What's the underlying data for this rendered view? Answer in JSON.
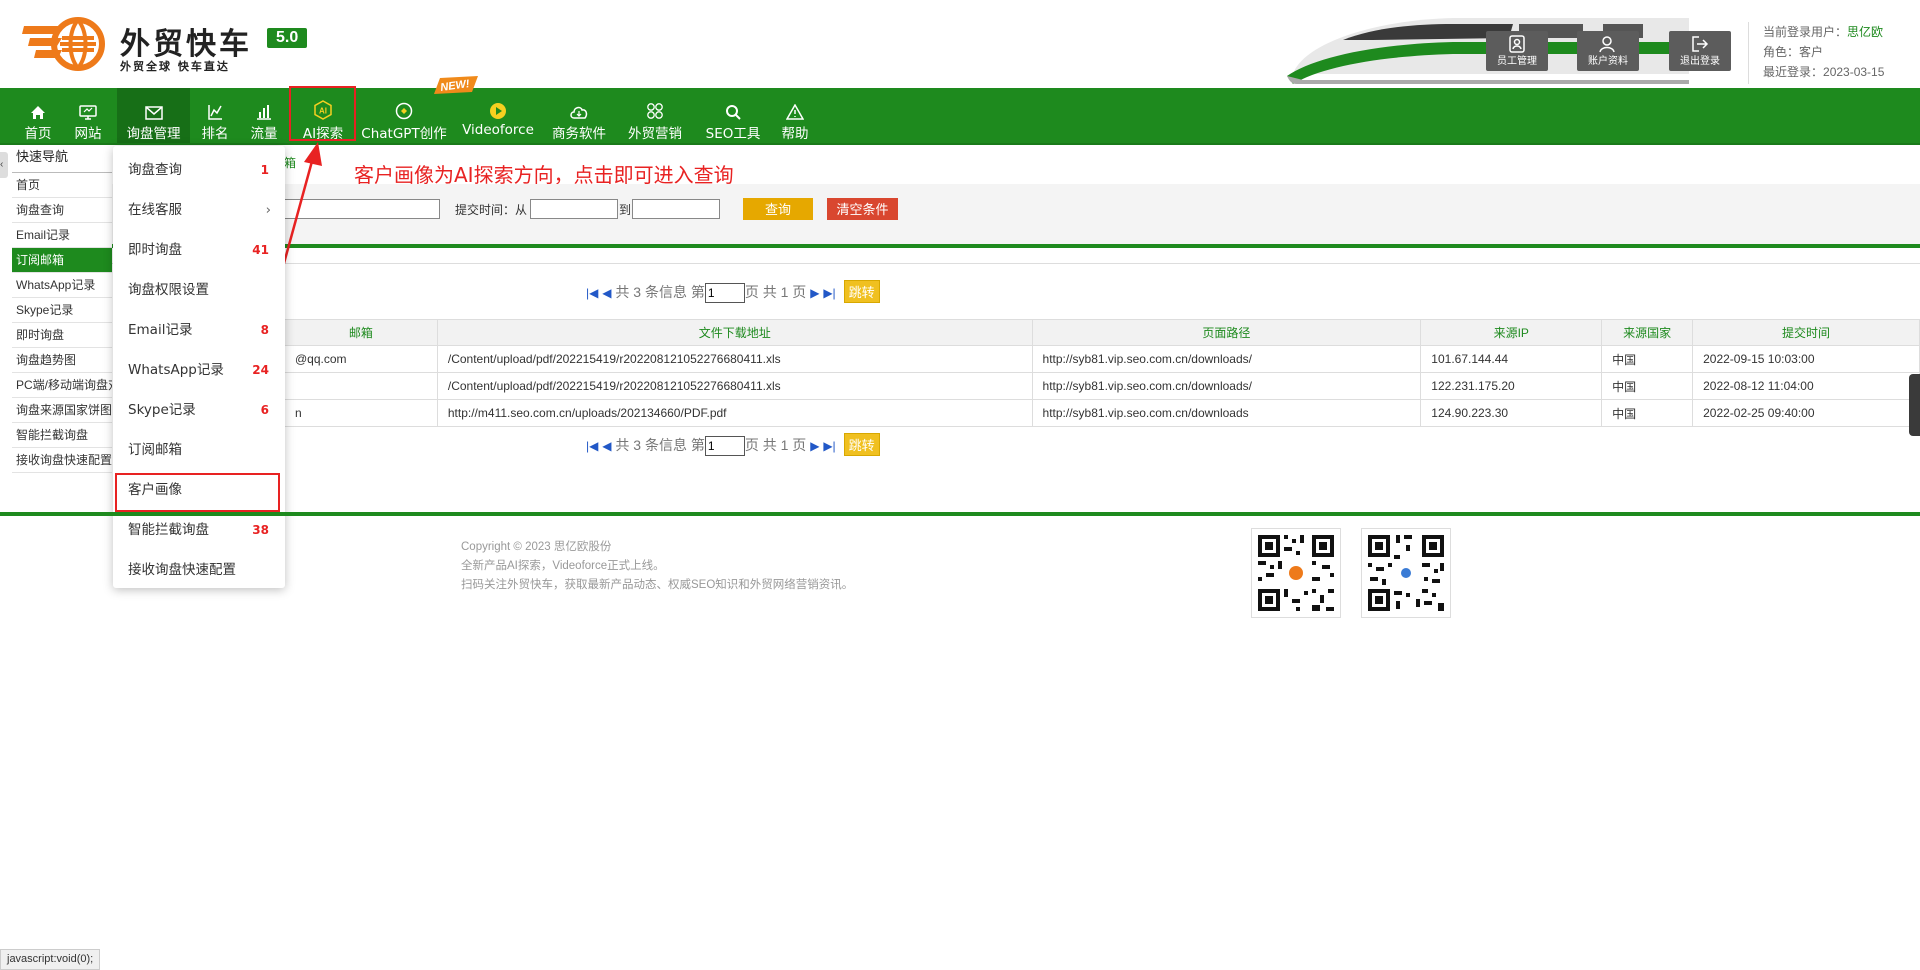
{
  "brand": {
    "name": "外贸快车",
    "version": "5.0",
    "slogan": "外贸全球 快车直达"
  },
  "header_buttons": [
    {
      "label": "员工管理",
      "icon": "staff-icon"
    },
    {
      "label": "账户资料",
      "icon": "account-icon"
    },
    {
      "label": "退出登录",
      "icon": "logout-icon"
    }
  ],
  "user": {
    "current_label": "当前登录用户：",
    "current_value": "思亿欧",
    "role_label": "角色：",
    "role_value": "客户",
    "last_login_label": "最近登录：",
    "last_login_value": "2023-03-15"
  },
  "nav": {
    "items": [
      {
        "label": "首页",
        "icon": "home-icon"
      },
      {
        "label": "网站",
        "icon": "monitor-icon"
      },
      {
        "label": "询盘管理",
        "icon": "mail-icon"
      },
      {
        "label": "排名",
        "icon": "ranking-icon"
      },
      {
        "label": "流量",
        "icon": "bar-chart-icon"
      },
      {
        "label": "AI探索",
        "icon": "ai-icon"
      },
      {
        "label": "ChatGPT创作",
        "icon": "chatgpt-icon"
      },
      {
        "label": "Videoforce",
        "icon": "play-icon"
      },
      {
        "label": "商务软件",
        "icon": "cloud-icon"
      },
      {
        "label": "外贸营销",
        "icon": "apps-icon"
      },
      {
        "label": "SEO工具",
        "icon": "search-icon"
      },
      {
        "label": "帮助",
        "icon": "warning-icon"
      }
    ],
    "new_badge": "NEW!"
  },
  "sidebar": {
    "title": "快速导航",
    "items": [
      {
        "label": "首页"
      },
      {
        "label": "询盘查询"
      },
      {
        "label": "Email记录"
      },
      {
        "label": "订阅邮箱"
      },
      {
        "label": "WhatsApp记录"
      },
      {
        "label": "Skype记录"
      },
      {
        "label": "即时询盘"
      },
      {
        "label": "询盘趋势图"
      },
      {
        "label": "PC端/移动端询盘对比"
      },
      {
        "label": "询盘来源国家饼图"
      },
      {
        "label": "智能拦截询盘"
      },
      {
        "label": "接收询盘快速配置"
      }
    ],
    "active_index": 3
  },
  "breadcrumb": "箱",
  "annotation": "客户画像为AI探索方向，点击即可进入查询",
  "filter": {
    "time_label": "提交时间：从",
    "to_label": "到",
    "query_button": "查询",
    "clear_button": "清空条件",
    "query_color": "#e6a800",
    "clear_color": "#d9472f"
  },
  "pager": {
    "first_icon": "first-page-icon",
    "prev_icon": "prev-page-icon",
    "text_total": "共 3 条信息 第",
    "page_value": "1",
    "text_pages": "页 共 1 页",
    "next_icon": "next-page-icon",
    "last_icon": "last-page-icon",
    "go_label": "跳转"
  },
  "table": {
    "columns": [
      "邮箱",
      "文件下载地址",
      "页面路径",
      "来源IP",
      "来源国家",
      "提交时间"
    ],
    "rows": [
      [
        "@qq.com",
        "/Content/upload/pdf/202215419/r20220812105227668041​1.xls",
        "http://syb81.vip.seo.com.cn/downloads/",
        "101.67.144.44",
        "中国",
        "2022-09-15 10:03:00"
      ],
      [
        "",
        "/Content/upload/pdf/202215419/r20220812105227668041​1.xls",
        "http://syb81.vip.seo.com.cn/downloads/",
        "122.231.175.20",
        "中国",
        "2022-08-12 11:04:00"
      ],
      [
        "n",
        "http://m411.seo.com.cn/uploads/202134660/PDF.pdf",
        "http://syb81.vip.seo.com.cn/downloads",
        "124.90.223.30",
        "中国",
        "2022-02-25 09:40:00"
      ]
    ]
  },
  "dropdown": {
    "items": [
      {
        "label": "询盘查询",
        "count": "1"
      },
      {
        "label": "在线客服",
        "count": "",
        "submenu": true
      },
      {
        "label": "即时询盘",
        "count": "41"
      },
      {
        "label": "询盘权限设置",
        "count": ""
      },
      {
        "label": "Email记录",
        "count": "8"
      },
      {
        "label": "WhatsApp记录",
        "count": "24"
      },
      {
        "label": "Skype记录",
        "count": "6"
      },
      {
        "label": "订阅邮箱",
        "count": ""
      },
      {
        "label": "客户画像",
        "count": ""
      },
      {
        "label": "智能拦截询盘",
        "count": "38"
      },
      {
        "label": "接收询盘快速配置",
        "count": ""
      }
    ]
  },
  "footer": {
    "copyright": "Copyright © 2023 思亿欧股份",
    "line2": "全新产品AI探索，Videoforce正式上线。",
    "line3": "扫码关注外贸快车，获取最新产品动态、权威SEO知识和外贸网络营销资讯。"
  },
  "status_bar": "javascript:void(0);",
  "colors": {
    "primary_green": "#1e8a1e",
    "highlight_red": "#e82222"
  }
}
